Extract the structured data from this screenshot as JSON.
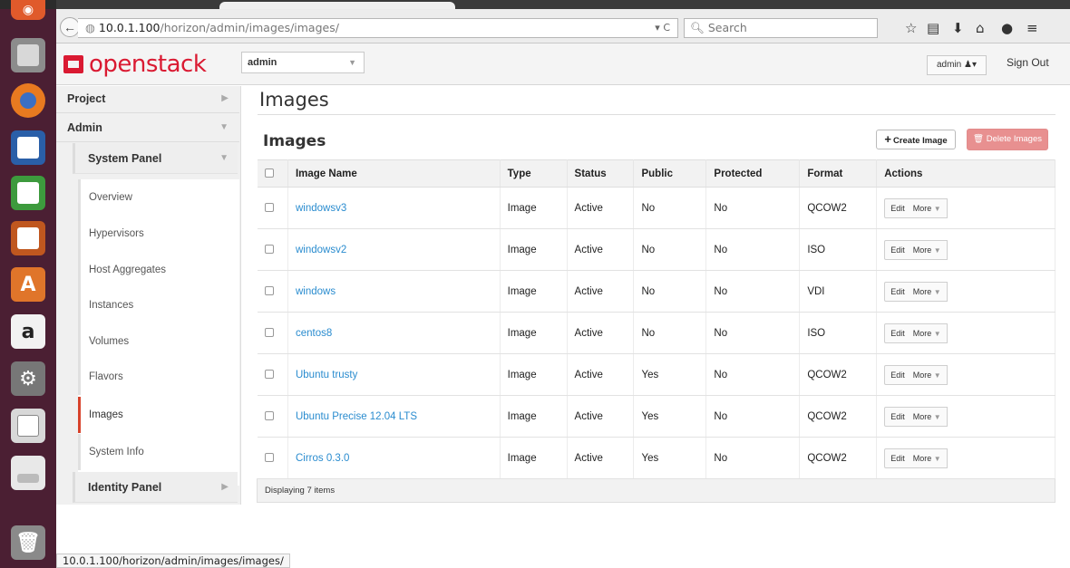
{
  "browser": {
    "url_host": "10.0.1.100",
    "url_path": "/horizon/admin/images/images/",
    "search_placeholder": "Search",
    "status_url": "10.0.1.100/horizon/admin/images/images/"
  },
  "header": {
    "brand": "openstack",
    "project": "admin",
    "user": "admin",
    "sign_out": "Sign Out"
  },
  "sidebar": {
    "project": "Project",
    "admin": "Admin",
    "system_panel": "System Panel",
    "links": [
      "Overview",
      "Hypervisors",
      "Host Aggregates",
      "Instances",
      "Volumes",
      "Flavors",
      "Images",
      "System Info"
    ],
    "identity_panel": "Identity Panel"
  },
  "main": {
    "page_title": "Images",
    "table_title": "Images",
    "create_label": "Create Image",
    "delete_label": "Delete Images",
    "columns": [
      "Image Name",
      "Type",
      "Status",
      "Public",
      "Protected",
      "Format",
      "Actions"
    ],
    "edit_label": "Edit",
    "more_label": "More",
    "rows": [
      {
        "name": "windowsv3",
        "type": "Image",
        "status": "Active",
        "public": "No",
        "protected": "No",
        "format": "QCOW2"
      },
      {
        "name": "windowsv2",
        "type": "Image",
        "status": "Active",
        "public": "No",
        "protected": "No",
        "format": "ISO"
      },
      {
        "name": "windows",
        "type": "Image",
        "status": "Active",
        "public": "No",
        "protected": "No",
        "format": "VDI"
      },
      {
        "name": "centos8",
        "type": "Image",
        "status": "Active",
        "public": "No",
        "protected": "No",
        "format": "ISO"
      },
      {
        "name": "Ubuntu trusty",
        "type": "Image",
        "status": "Active",
        "public": "Yes",
        "protected": "No",
        "format": "QCOW2"
      },
      {
        "name": "Ubuntu Precise 12.04 LTS",
        "type": "Image",
        "status": "Active",
        "public": "Yes",
        "protected": "No",
        "format": "QCOW2"
      },
      {
        "name": "Cirros 0.3.0",
        "type": "Image",
        "status": "Active",
        "public": "Yes",
        "protected": "No",
        "format": "QCOW2"
      }
    ],
    "footer": "Displaying 7 items"
  },
  "colors": {
    "brand_red": "#da1a32",
    "link_blue": "#2a8ccf",
    "delete_red": "#e89090",
    "active_marker": "#d7422b",
    "launcher_bg": "#4b1f33"
  }
}
